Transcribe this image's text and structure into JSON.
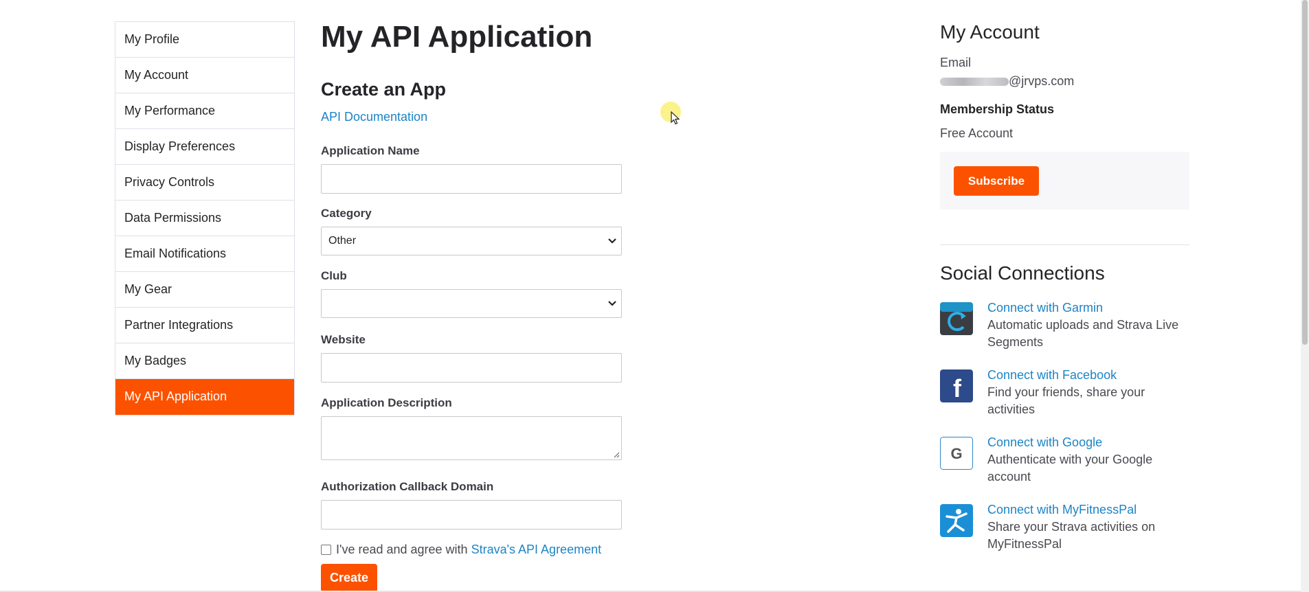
{
  "sidebar": {
    "items": [
      {
        "label": "My Profile"
      },
      {
        "label": "My Account"
      },
      {
        "label": "My Performance"
      },
      {
        "label": "Display Preferences"
      },
      {
        "label": "Privacy Controls"
      },
      {
        "label": "Data Permissions"
      },
      {
        "label": "Email Notifications"
      },
      {
        "label": "My Gear"
      },
      {
        "label": "Partner Integrations"
      },
      {
        "label": "My Badges"
      },
      {
        "label": "My API Application"
      }
    ],
    "active_index": 10
  },
  "main": {
    "title": "My API Application",
    "section_title": "Create an App",
    "doc_link": "API Documentation",
    "fields": {
      "app_name": {
        "label": "Application Name",
        "value": ""
      },
      "category": {
        "label": "Category",
        "value": "Other"
      },
      "club": {
        "label": "Club",
        "value": ""
      },
      "website": {
        "label": "Website",
        "value": ""
      },
      "description": {
        "label": "Application Description",
        "value": ""
      },
      "callback": {
        "label": "Authorization Callback Domain",
        "value": ""
      }
    },
    "agree": {
      "text": "I've read and agree with",
      "link": "Strava's API Agreement",
      "checked": false
    },
    "create_label": "Create"
  },
  "account": {
    "heading": "My Account",
    "email_label": "Email",
    "email_suffix": "@jrvps.com",
    "membership_label": "Membership Status",
    "membership_value": "Free Account",
    "subscribe_label": "Subscribe"
  },
  "social": {
    "heading": "Social Connections",
    "items": [
      {
        "link": "Connect with Garmin",
        "desc": "Automatic uploads and Strava Live Segments",
        "icon": "garmin-icon"
      },
      {
        "link": "Connect with Facebook",
        "desc": "Find your friends, share your activities",
        "icon": "facebook-icon"
      },
      {
        "link": "Connect with Google",
        "desc": "Authenticate with your Google account",
        "icon": "google-icon"
      },
      {
        "link": "Connect with MyFitnessPal",
        "desc": "Share your Strava activities on MyFitnessPal",
        "icon": "myfitnesspal-icon"
      }
    ]
  },
  "colors": {
    "accent": "#fc5200",
    "link": "#1c84c6",
    "text": "#242428"
  }
}
